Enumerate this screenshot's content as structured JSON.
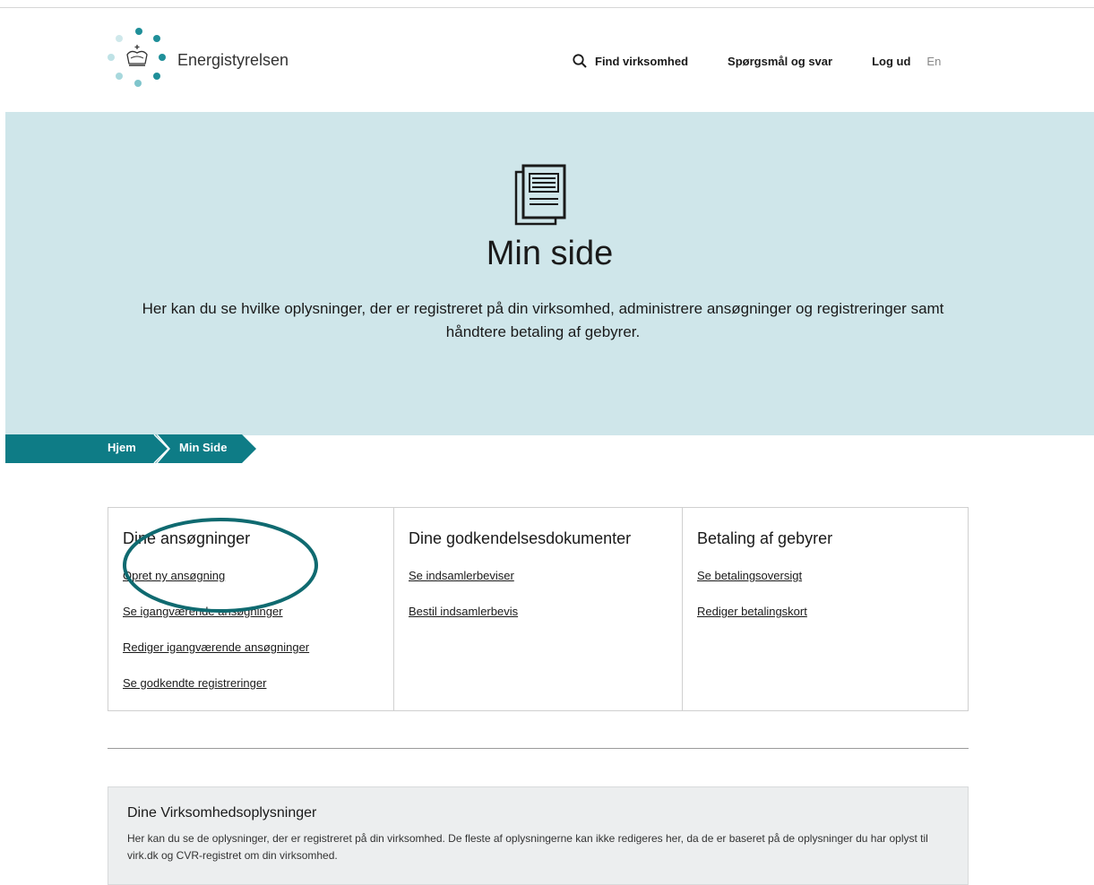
{
  "header": {
    "brand": "Energistyrelsen",
    "nav": {
      "find": "Find virksomhed",
      "faq": "Spørgsmål og svar",
      "logout": "Log ud",
      "lang": "En"
    }
  },
  "hero": {
    "icon": "document-stack-icon",
    "title": "Min side",
    "text": "Her kan du se hvilke oplysninger, der er registreret på din virksomhed, administrere ansøgninger og registreringer samt håndtere betaling af gebyrer."
  },
  "breadcrumb": {
    "home": "Hjem",
    "current": "Min Side"
  },
  "cards": [
    {
      "title": "Dine ansøgninger",
      "links": [
        "Opret ny ansøgning",
        "Se igangværende ansøgninger",
        "Rediger igangværende ansøgninger",
        "Se godkendte registreringer"
      ]
    },
    {
      "title": "Dine godkendelsesdokumenter",
      "links": [
        "Se indsamlerbeviser",
        "Bestil indsamlerbevis"
      ]
    },
    {
      "title": "Betaling af gebyrer",
      "links": [
        "Se betalingsoversigt",
        "Rediger betalingskort"
      ]
    }
  ],
  "info": {
    "title": "Dine Virksomhedsoplysninger",
    "text": "Her kan du se de oplysninger, der er registreret på din virksomhed. De fleste af oplysningerne kan ikke redigeres her, da de er baseret på de oplysninger du har oplyst til virk.dk og CVR-registret om din virksomhed."
  },
  "colors": {
    "accent": "#0e7c86",
    "hero_bg": "#cfe6ea",
    "annotation": "#0f6a70"
  }
}
